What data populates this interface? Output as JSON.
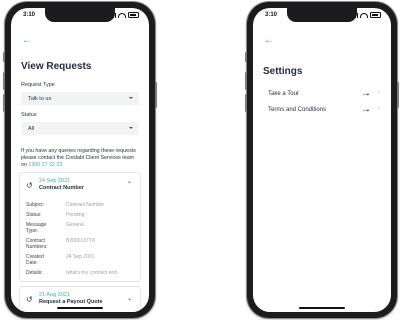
{
  "colors": {
    "accent": "#3bb3a6",
    "text": "#1f2d3d",
    "muted": "#9aa0a6",
    "field_bg": "#f2f3f5"
  },
  "left_screen": {
    "status_time": "3:10",
    "back_icon": "arrow-left-icon",
    "title": "View Requests",
    "request_type": {
      "label": "Request Type",
      "value": "Talk to us"
    },
    "status": {
      "label": "Status",
      "value": "All"
    },
    "info_text": "If you have any queries regarding these requests please contact the Credabl Client Services team on",
    "info_phone": "1300 27 32 22",
    "requests": [
      {
        "date": "24 Sep 2021",
        "subject": "Contract Number",
        "expanded": true,
        "details": [
          {
            "label": "Subject:",
            "value": "Contract Number"
          },
          {
            "label": "Status:",
            "value": "Pending"
          },
          {
            "label": "Message Type:",
            "value": "General"
          },
          {
            "label": "Contract Numbers:",
            "value": "B2000137TX"
          },
          {
            "label": "Created Date:",
            "value": "24 Sep 2021"
          },
          {
            "label": "Details:",
            "value": "what's my contract end"
          }
        ]
      },
      {
        "date": "21 Aug 2021",
        "subject": "Request a Payout Quote",
        "expanded": false
      }
    ]
  },
  "right_screen": {
    "status_time": "3:10",
    "back_icon": "arrow-left-icon",
    "title": "Settings",
    "items": [
      {
        "label": "Take a Tour"
      },
      {
        "label": "Terms and Conditions"
      }
    ]
  }
}
